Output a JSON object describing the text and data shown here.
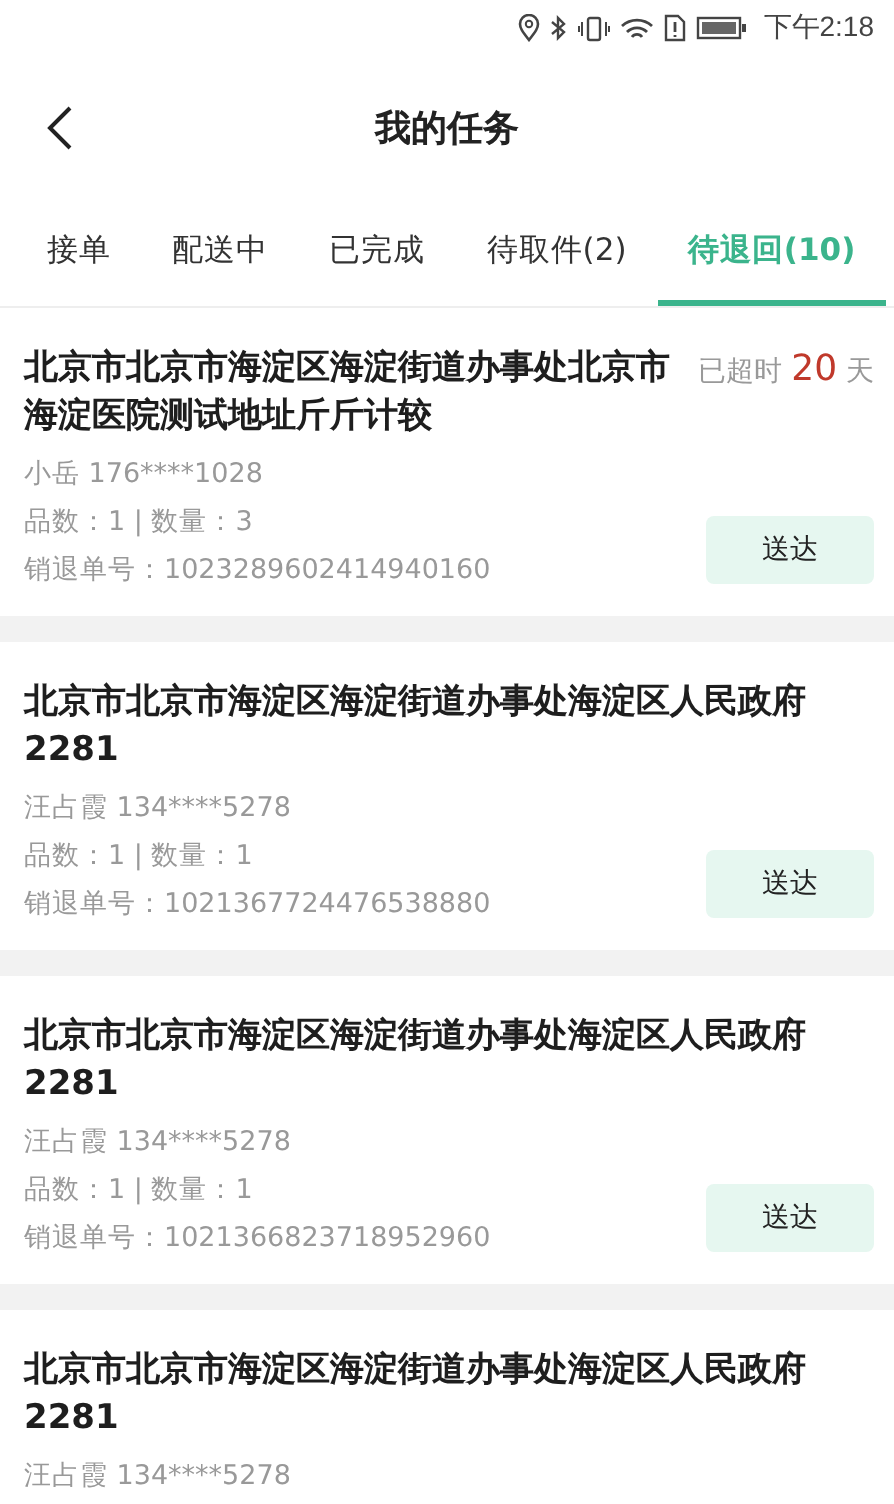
{
  "status_bar": {
    "time": "下午2:18"
  },
  "header": {
    "title": "我的任务"
  },
  "tabs": [
    {
      "label": "接单",
      "selected": false
    },
    {
      "label": "配送中",
      "selected": false
    },
    {
      "label": "已完成",
      "selected": false
    },
    {
      "label": "待取件(2)",
      "selected": false
    },
    {
      "label": "待退回(10)",
      "selected": true
    }
  ],
  "orders": [
    {
      "address": "北京市北京市海淀区海淀街道办事处北京市海淀医院测试地址斤斤计较",
      "overdue": {
        "prefix": "已超时",
        "days": "20",
        "suffix": "天"
      },
      "contact": "小岳  176****1028",
      "quantity": "品数：1 | 数量：3",
      "return_no": "销退单号：1023289602414940160",
      "button": "送达"
    },
    {
      "address": "北京市北京市海淀区海淀街道办事处海淀区人民政府2281",
      "contact": "汪占霞  134****5278",
      "quantity": "品数：1 | 数量：1",
      "return_no": "销退单号：1021367724476538880",
      "button": "送达"
    },
    {
      "address": "北京市北京市海淀区海淀街道办事处海淀区人民政府2281",
      "contact": "汪占霞  134****5278",
      "quantity": "品数：1 | 数量：1",
      "return_no": "销退单号：1021366823718952960",
      "button": "送达"
    },
    {
      "address": "北京市北京市海淀区海淀街道办事处海淀区人民政府2281",
      "contact": "汪占霞  134****5278"
    }
  ]
}
